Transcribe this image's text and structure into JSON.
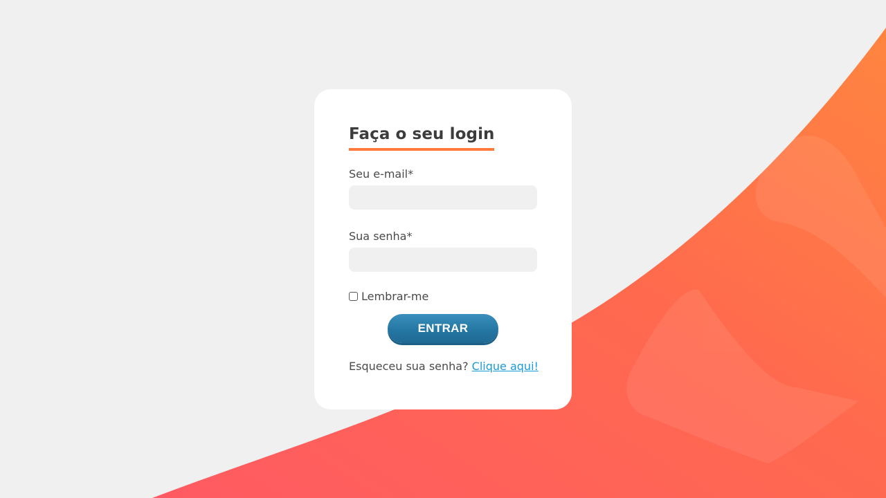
{
  "colors": {
    "background": "#f0f0f0",
    "accent": "#ff7a3d",
    "button": "#2577a3",
    "link": "#1b9ad8"
  },
  "login": {
    "title": "Faça o seu login",
    "email_label": "Seu e-mail*",
    "email_value": "",
    "password_label": "Sua senha*",
    "password_value": "",
    "remember_label": "Lembrar-me",
    "remember_checked": false,
    "submit_label": "ENTRAR",
    "forgot_text": "Esqueceu sua senha?",
    "forgot_link": "Clique aqui!"
  }
}
